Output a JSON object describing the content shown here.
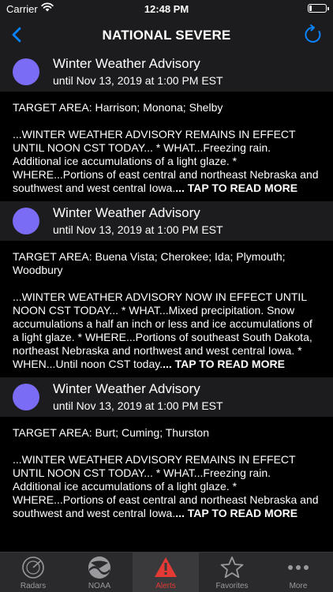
{
  "status_bar": {
    "carrier": "Carrier",
    "time": "12:48 PM",
    "battery_level": 0.15
  },
  "nav": {
    "title": "NATIONAL SEVERE"
  },
  "colors": {
    "accent": "#0a84ff",
    "alert_dot": "#7b6cf6",
    "active_tab": "#e53935"
  },
  "alerts": [
    {
      "name": "Winter Weather Advisory",
      "until": "until Nov 13, 2019 at 1:00 PM EST",
      "target_area": "TARGET AREA: Harrison; Monona; Shelby",
      "description": "...WINTER WEATHER ADVISORY REMAINS IN EFFECT UNTIL NOON CST TODAY... * WHAT...Freezing rain. Additional ice accumulations of a light glaze. * WHERE...Portions of east central and northeast Nebraska and southwest and west central Iowa.",
      "more": "... TAP TO READ MORE"
    },
    {
      "name": "Winter Weather Advisory",
      "until": "until Nov 13, 2019 at 1:00 PM EST",
      "target_area": "TARGET AREA: Buena Vista; Cherokee; Ida; Plymouth; Woodbury",
      "description": "...WINTER WEATHER ADVISORY NOW IN EFFECT UNTIL NOON CST TODAY... * WHAT...Mixed precipitation. Snow accumulations a half an inch or less and ice accumulations of a light glaze. * WHERE...Portions of southeast South Dakota, northeast Nebraska and northwest and west central Iowa. * WHEN...Until noon CST today.",
      "more": "... TAP TO READ MORE"
    },
    {
      "name": "Winter Weather Advisory",
      "until": "until Nov 13, 2019 at 1:00 PM EST",
      "target_area": "TARGET AREA: Burt; Cuming; Thurston",
      "description": "...WINTER WEATHER ADVISORY REMAINS IN EFFECT UNTIL NOON CST TODAY... * WHAT...Freezing rain. Additional ice accumulations of a light glaze. * WHERE...Portions of east central and northeast Nebraska and southwest and west central Iowa.",
      "more": "... TAP TO READ MORE"
    }
  ],
  "tabs": [
    {
      "label": "Radars",
      "icon": "radar-icon"
    },
    {
      "label": "NOAA",
      "icon": "noaa-logo-icon"
    },
    {
      "label": "Alerts",
      "icon": "warning-icon",
      "active": true
    },
    {
      "label": "Favorites",
      "icon": "star-icon"
    },
    {
      "label": "More",
      "icon": "more-dots-icon"
    }
  ]
}
